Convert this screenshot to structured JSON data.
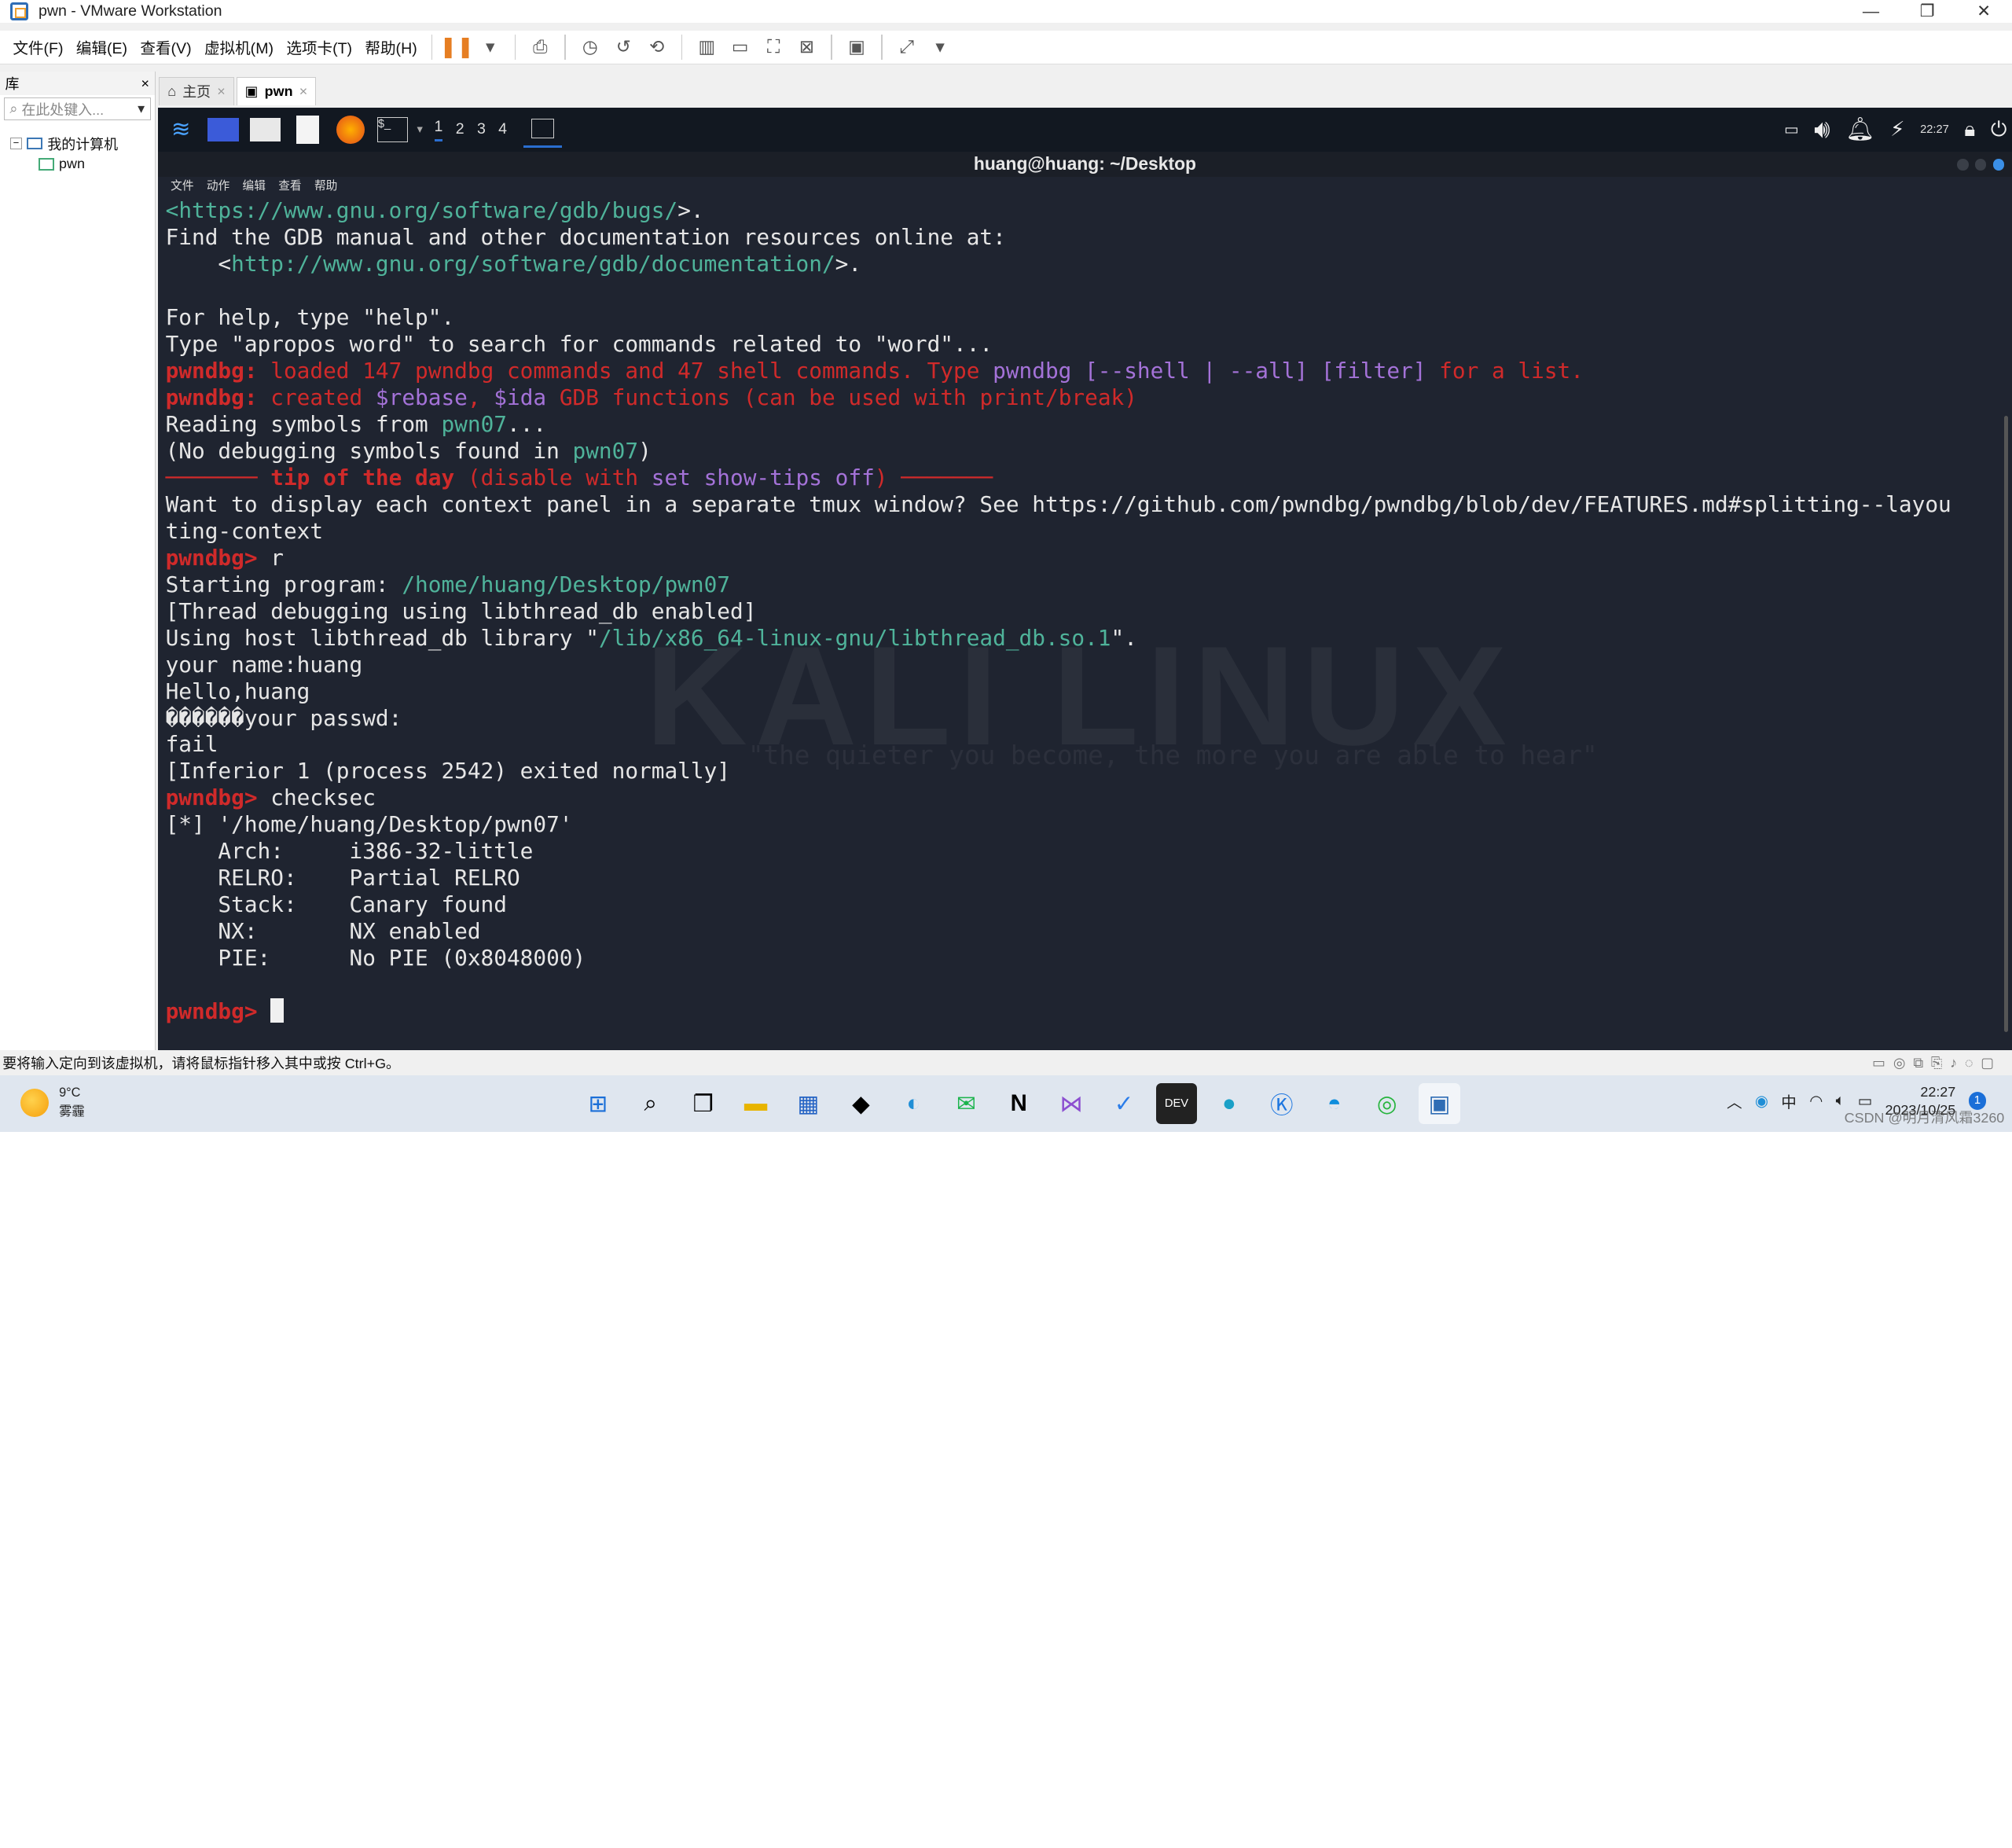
{
  "window": {
    "title": "pwn - VMware Workstation"
  },
  "menu": [
    "文件(F)",
    "编辑(E)",
    "查看(V)",
    "虚拟机(M)",
    "选项卡(T)",
    "帮助(H)"
  ],
  "library": {
    "title": "库",
    "close": "×",
    "search_placeholder": "在此处键入...",
    "tree_root": "我的计算机",
    "tree_child": "pwn"
  },
  "tabs": [
    {
      "label": "主页",
      "close": "×"
    },
    {
      "label": "pwn",
      "close": "×"
    }
  ],
  "kali": {
    "workspaces": [
      "1",
      "2",
      "3",
      "4"
    ],
    "clock": "22:27"
  },
  "terminal": {
    "title": "huang@huang: ~/Desktop",
    "menu": [
      "文件",
      "动作",
      "编辑",
      "查看",
      "帮助"
    ],
    "lines": [
      [
        {
          "t": "<",
          "c": "c-green"
        },
        {
          "t": "https://www.gnu.org/software/gdb/bugs/",
          "c": "c-green"
        },
        {
          "t": ">."
        }
      ],
      [
        {
          "t": "Find the GDB manual and other documentation resources online at:"
        }
      ],
      [
        {
          "t": "    <"
        },
        {
          "t": "http://www.gnu.org/software/gdb/documentation/",
          "c": "c-green"
        },
        {
          "t": ">."
        }
      ],
      [
        {
          "t": ""
        }
      ],
      [
        {
          "t": "For help, type \"help\"."
        }
      ],
      [
        {
          "t": "Type \"apropos word\" to search for commands related to \"word\"..."
        }
      ],
      [
        {
          "t": "pwndbg:",
          "c": "c-redb"
        },
        {
          "t": " loaded 147 pwndbg commands and 47 shell commands. Type ",
          "c": "c-red"
        },
        {
          "t": "pwndbg [--shell | --all] [filter]",
          "c": "c-purple"
        },
        {
          "t": " for a list.",
          "c": "c-red"
        }
      ],
      [
        {
          "t": "pwndbg:",
          "c": "c-redb"
        },
        {
          "t": " created ",
          "c": "c-red"
        },
        {
          "t": "$rebase",
          "c": "c-purple"
        },
        {
          "t": ", ",
          "c": "c-red"
        },
        {
          "t": "$ida",
          "c": "c-purple"
        },
        {
          "t": " GDB functions (can be used with print/break)",
          "c": "c-red"
        }
      ],
      [
        {
          "t": "Reading symbols from "
        },
        {
          "t": "pwn07",
          "c": "c-green"
        },
        {
          "t": "..."
        }
      ],
      [
        {
          "t": "(No debugging symbols found in "
        },
        {
          "t": "pwn07",
          "c": "c-green"
        },
        {
          "t": ")"
        }
      ],
      [
        {
          "t": "─────── ",
          "c": "c-red"
        },
        {
          "t": "tip of the day",
          "c": "c-redb"
        },
        {
          "t": " (disable with ",
          "c": "c-red"
        },
        {
          "t": "set show-tips off",
          "c": "c-purple"
        },
        {
          "t": ") ───────",
          "c": "c-red"
        }
      ],
      [
        {
          "t": "Want to display each context panel in a separate tmux window? See https://github.com/pwndbg/pwndbg/blob/dev/FEATURES.md#splitting--layou"
        }
      ],
      [
        {
          "t": "ting-context"
        }
      ],
      [
        {
          "t": "pwndbg>",
          "c": "c-redb"
        },
        {
          "t": " r"
        }
      ],
      [
        {
          "t": "Starting program: "
        },
        {
          "t": "/home/huang/Desktop/pwn07",
          "c": "c-green"
        }
      ],
      [
        {
          "t": "[Thread debugging using libthread_db enabled]"
        }
      ],
      [
        {
          "t": "Using host libthread_db library \""
        },
        {
          "t": "/lib/x86_64-linux-gnu/libthread_db.so.1",
          "c": "c-green"
        },
        {
          "t": "\"."
        }
      ],
      [
        {
          "t": "your name:huang"
        }
      ],
      [
        {
          "t": "Hello,huang"
        }
      ],
      [
        {
          "t": "������your passwd:"
        }
      ],
      [
        {
          "t": "fail"
        }
      ],
      [
        {
          "t": "[Inferior 1 (process 2542) exited normally]"
        }
      ],
      [
        {
          "t": "pwndbg>",
          "c": "c-redb"
        },
        {
          "t": " checksec"
        }
      ],
      [
        {
          "t": "[*] '/home/huang/Desktop/pwn07'"
        }
      ],
      [
        {
          "t": "    Arch:     i386-32-little"
        }
      ],
      [
        {
          "t": "    RELRO:    Partial RELRO"
        }
      ],
      [
        {
          "t": "    Stack:    Canary found"
        }
      ],
      [
        {
          "t": "    NX:       NX enabled"
        }
      ],
      [
        {
          "t": "    PIE:      No PIE (0x8048000)"
        }
      ],
      [
        {
          "t": ""
        }
      ],
      [
        {
          "t": "pwndbg>",
          "c": "c-redb"
        },
        {
          "t": " "
        }
      ]
    ]
  },
  "wallpaper": {
    "text": "KALI LINUX",
    "quote": "\"the quieter you become, the more you are able to hear\""
  },
  "statusbar": {
    "text": "要将输入定向到该虚拟机，请将鼠标指针移入其中或按 Ctrl+G。"
  },
  "taskbar": {
    "weather_temp": "9°C",
    "weather_desc": "雾霾",
    "ime": "中",
    "time": "22:27",
    "date": "2023/10/25",
    "notif_count": "1",
    "watermark": "CSDN @明月清风霜3260"
  }
}
